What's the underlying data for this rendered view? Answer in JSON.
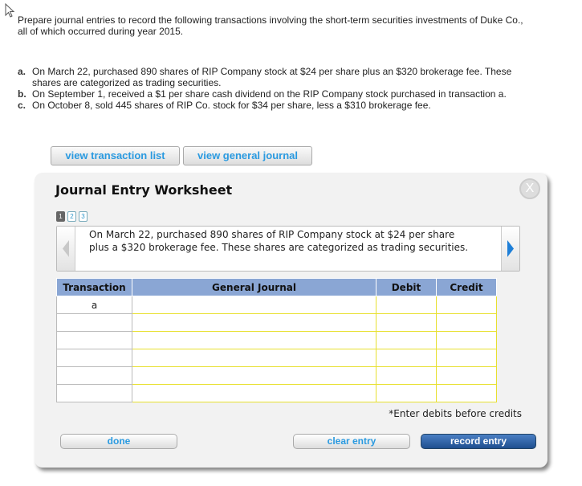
{
  "intro": "Prepare journal entries to record the following transactions involving the short-term securities investments of Duke Co., all of which occurred during year 2015.",
  "transactions": [
    {
      "letter": "a.",
      "text": "On March 22, purchased 890 shares of RIP Company stock at $24 per share plus an $320 brokerage fee. These shares are categorized as trading securities."
    },
    {
      "letter": "b.",
      "text": "On September 1, received a $1 per share cash dividend on the RIP Company stock purchased in transaction a."
    },
    {
      "letter": "c.",
      "text": "On October 8, sold 445 shares of RIP Co. stock for $34 per share, less a $310 brokerage fee."
    }
  ],
  "buttons": {
    "view_transactions": "view transaction list",
    "view_journal": "view general journal",
    "done": "done",
    "clear": "clear entry",
    "record": "record entry"
  },
  "worksheet": {
    "title": "Journal Entry Worksheet",
    "close": "X",
    "pages": [
      "1",
      "2",
      "3"
    ],
    "description": "On March 22, purchased 890 shares of RIP Company stock at $24 per share plus a $320 brokerage fee. These shares are categorized as trading securities.",
    "columns": [
      "Transaction",
      "General Journal",
      "Debit",
      "Credit"
    ],
    "rows": [
      {
        "transaction": "a"
      },
      {
        "transaction": ""
      },
      {
        "transaction": ""
      },
      {
        "transaction": ""
      },
      {
        "transaction": ""
      },
      {
        "transaction": ""
      }
    ],
    "note": "*Enter debits before credits"
  }
}
